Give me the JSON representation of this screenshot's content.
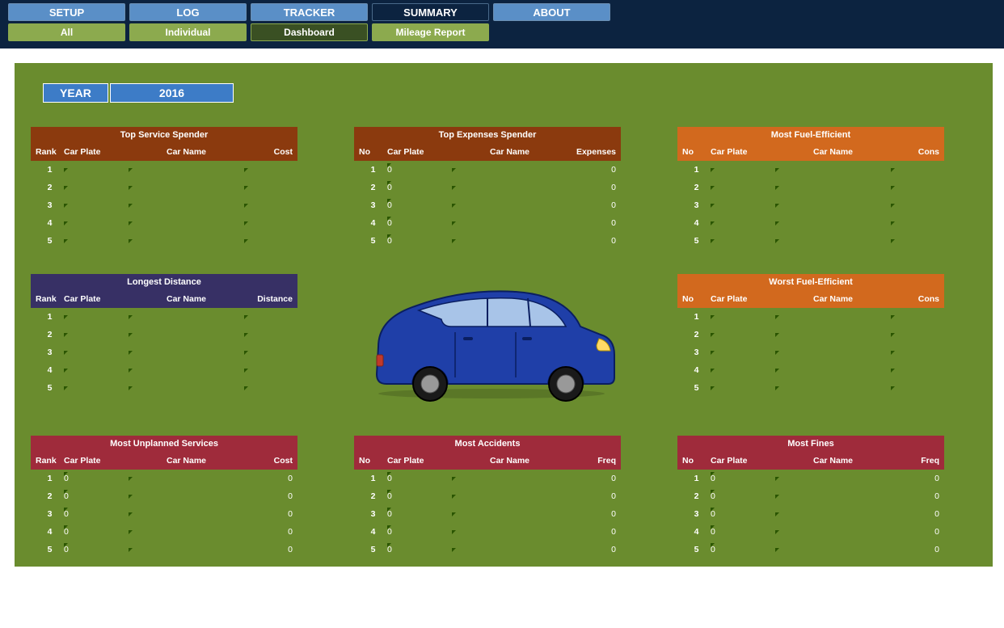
{
  "nav": {
    "tabs": [
      "SETUP",
      "LOG",
      "TRACKER",
      "SUMMARY",
      "ABOUT"
    ],
    "subtabs": [
      "All",
      "Individual",
      "Dashboard",
      "Mileage Report"
    ]
  },
  "year": {
    "label": "YEAR",
    "value": "2016"
  },
  "cards": {
    "service": {
      "title": "Top Service Spender",
      "cols": [
        "Rank",
        "Car Plate",
        "Car Name",
        "Cost"
      ],
      "rows": [
        {
          "r": "1",
          "p": "",
          "n": "",
          "v": ""
        },
        {
          "r": "2",
          "p": "",
          "n": "",
          "v": ""
        },
        {
          "r": "3",
          "p": "",
          "n": "",
          "v": ""
        },
        {
          "r": "4",
          "p": "",
          "n": "",
          "v": ""
        },
        {
          "r": "5",
          "p": "",
          "n": "",
          "v": ""
        }
      ]
    },
    "expenses": {
      "title": "Top Expenses Spender",
      "cols": [
        "No",
        "Car Plate",
        "Car Name",
        "Expenses"
      ],
      "rows": [
        {
          "r": "1",
          "p": "0",
          "n": "",
          "v": "0"
        },
        {
          "r": "2",
          "p": "0",
          "n": "",
          "v": "0"
        },
        {
          "r": "3",
          "p": "0",
          "n": "",
          "v": "0"
        },
        {
          "r": "4",
          "p": "0",
          "n": "",
          "v": "0"
        },
        {
          "r": "5",
          "p": "0",
          "n": "",
          "v": "0"
        }
      ]
    },
    "mostfuel": {
      "title": "Most Fuel-Efficient",
      "cols": [
        "No",
        "Car Plate",
        "Car Name",
        "Cons"
      ],
      "rows": [
        {
          "r": "1",
          "p": "",
          "n": "",
          "v": ""
        },
        {
          "r": "2",
          "p": "",
          "n": "",
          "v": ""
        },
        {
          "r": "3",
          "p": "",
          "n": "",
          "v": ""
        },
        {
          "r": "4",
          "p": "",
          "n": "",
          "v": ""
        },
        {
          "r": "5",
          "p": "",
          "n": "",
          "v": ""
        }
      ]
    },
    "distance": {
      "title": "Longest Distance",
      "cols": [
        "Rank",
        "Car Plate",
        "Car Name",
        "Distance"
      ],
      "rows": [
        {
          "r": "1",
          "p": "",
          "n": "",
          "v": ""
        },
        {
          "r": "2",
          "p": "",
          "n": "",
          "v": ""
        },
        {
          "r": "3",
          "p": "",
          "n": "",
          "v": ""
        },
        {
          "r": "4",
          "p": "",
          "n": "",
          "v": ""
        },
        {
          "r": "5",
          "p": "",
          "n": "",
          "v": ""
        }
      ]
    },
    "worstfuel": {
      "title": "Worst Fuel-Efficient",
      "cols": [
        "No",
        "Car Plate",
        "Car Name",
        "Cons"
      ],
      "rows": [
        {
          "r": "1",
          "p": "",
          "n": "",
          "v": ""
        },
        {
          "r": "2",
          "p": "",
          "n": "",
          "v": ""
        },
        {
          "r": "3",
          "p": "",
          "n": "",
          "v": ""
        },
        {
          "r": "4",
          "p": "",
          "n": "",
          "v": ""
        },
        {
          "r": "5",
          "p": "",
          "n": "",
          "v": ""
        }
      ]
    },
    "unplanned": {
      "title": "Most Unplanned Services",
      "cols": [
        "Rank",
        "Car Plate",
        "Car Name",
        "Cost"
      ],
      "rows": [
        {
          "r": "1",
          "p": "0",
          "n": "",
          "v": "0"
        },
        {
          "r": "2",
          "p": "0",
          "n": "",
          "v": "0"
        },
        {
          "r": "3",
          "p": "0",
          "n": "",
          "v": "0"
        },
        {
          "r": "4",
          "p": "0",
          "n": "",
          "v": "0"
        },
        {
          "r": "5",
          "p": "0",
          "n": "",
          "v": "0"
        }
      ]
    },
    "accidents": {
      "title": "Most Accidents",
      "cols": [
        "No",
        "Car Plate",
        "Car Name",
        "Freq"
      ],
      "rows": [
        {
          "r": "1",
          "p": "0",
          "n": "",
          "v": "0"
        },
        {
          "r": "2",
          "p": "0",
          "n": "",
          "v": "0"
        },
        {
          "r": "3",
          "p": "0",
          "n": "",
          "v": "0"
        },
        {
          "r": "4",
          "p": "0",
          "n": "",
          "v": "0"
        },
        {
          "r": "5",
          "p": "0",
          "n": "",
          "v": "0"
        }
      ]
    },
    "fines": {
      "title": "Most Fines",
      "cols": [
        "No",
        "Car Plate",
        "Car Name",
        "Freq"
      ],
      "rows": [
        {
          "r": "1",
          "p": "0",
          "n": "",
          "v": "0"
        },
        {
          "r": "2",
          "p": "0",
          "n": "",
          "v": "0"
        },
        {
          "r": "3",
          "p": "0",
          "n": "",
          "v": "0"
        },
        {
          "r": "4",
          "p": "0",
          "n": "",
          "v": "0"
        },
        {
          "r": "5",
          "p": "0",
          "n": "",
          "v": "0"
        }
      ]
    }
  }
}
